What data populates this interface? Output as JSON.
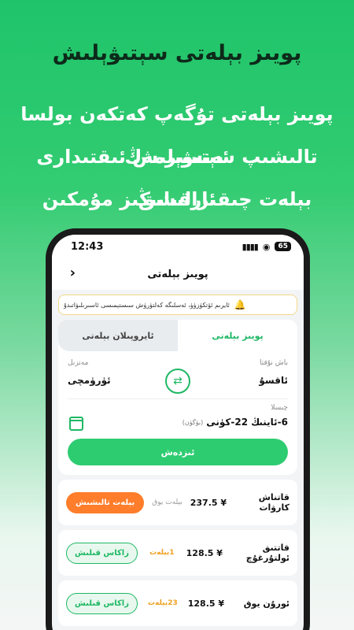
{
  "promo": {
    "title": "پويىز بېلەتى سېتىۋېلىش",
    "lines": [
      "پويىز بېلەتى تۇگەپ كەتكەن بولسا ئەنسىرمەڭ",
      "تالىشىپ سېتىۋېلىش ئىقتىدارى ئارقىلىق",
      "بېلەت چىقىرالىشىڭىز مۇمكىن"
    ]
  },
  "status": {
    "time": "12:43",
    "battery": "65"
  },
  "nav": {
    "title": "پويىز بېلەتى"
  },
  "notice": {
    "text": "ئايرىم ئۆتكۈزۈۈ، ئەسلىگە كەلتۈرۈش سىستېمىسى ئاسىرىلىۋاتىدۇ"
  },
  "tabs": [
    {
      "label": "پويىز بېلەتى"
    },
    {
      "label": "ئايروپىلان بېلەتى"
    }
  ],
  "route": {
    "from_label": "باش نۇقتا",
    "from_name": "ئاقسۇ",
    "to_label": "مەنزىل",
    "to_name": "ئۈرۈمچى"
  },
  "date": {
    "label": "چىسلا",
    "value": "6-ئاينىڭ 22-كۈنى",
    "sub": "(بۈگۈن)"
  },
  "search": {
    "label": "ئىزدەش"
  },
  "trains": [
    {
      "name": "قاتناش كارۋات",
      "price": "¥ 237.5",
      "seats": "بېلەت يوق",
      "action": "بېلەت تالىشىش",
      "style": "orange"
    },
    {
      "name": "قاتتىق ئولتۇرغۇچ",
      "price": "¥ 128.5",
      "seats": "1بېلەت",
      "action": "زاكاس قىلىش",
      "style": "outline"
    },
    {
      "name": "ئورۇن يوق",
      "price": "¥ 128.5",
      "seats": "23بېلەت",
      "action": "زاكاس قىلىش",
      "style": "outline"
    }
  ]
}
